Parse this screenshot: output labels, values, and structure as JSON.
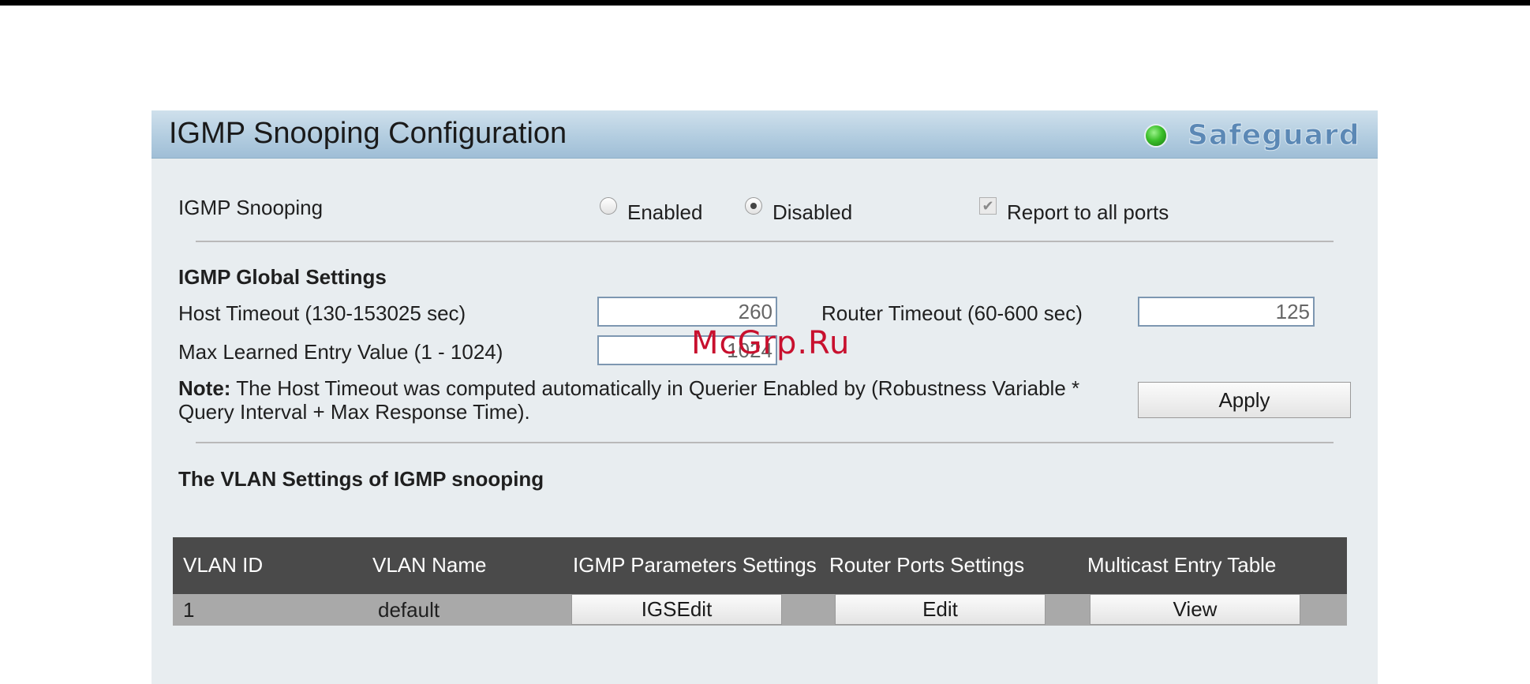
{
  "page": {
    "title": "IGMP Snooping Configuration",
    "safeguard_label": "Safeguard"
  },
  "snooping": {
    "label": "IGMP Snooping",
    "enabled_label": "Enabled",
    "disabled_label": "Disabled",
    "selected": "Disabled",
    "report_label": "Report to all ports",
    "report_checked": true
  },
  "global": {
    "heading": "IGMP Global Settings",
    "host_timeout_label": "Host Timeout (130-153025 sec)",
    "host_timeout_value": "260",
    "router_timeout_label": "Router Timeout (60-600 sec)",
    "router_timeout_value": "125",
    "max_entry_label": "Max Learned Entry Value (1 - 1024)",
    "max_entry_value": "1024",
    "note_prefix": "Note:",
    "note_line1": " The Host Timeout was computed automatically in Querier Enabled by (Robustness Variable *",
    "note_line2": "Query Interval + Max Response Time).",
    "apply_label": "Apply"
  },
  "vlan": {
    "heading": "The VLAN Settings of IGMP snooping",
    "columns": [
      "VLAN ID",
      "VLAN Name",
      "IGMP Parameters Settings",
      "Router Ports Settings",
      "Multicast Entry Table"
    ],
    "rows": [
      {
        "vlan_id": "1",
        "vlan_name": "default",
        "igmp_button": "IGSEdit",
        "router_button": "Edit",
        "multicast_button": "View"
      }
    ]
  },
  "watermark": "McGrp.Ru",
  "colors": {
    "title_bar": "#b3cde0",
    "panel_bg": "#e8edf0",
    "table_header": "#4a4a4a",
    "table_row": "#a9a9a9",
    "safeguard_text": "#5b88b5",
    "safeguard_led": "#3bbf2a",
    "watermark": "#c8102e"
  }
}
